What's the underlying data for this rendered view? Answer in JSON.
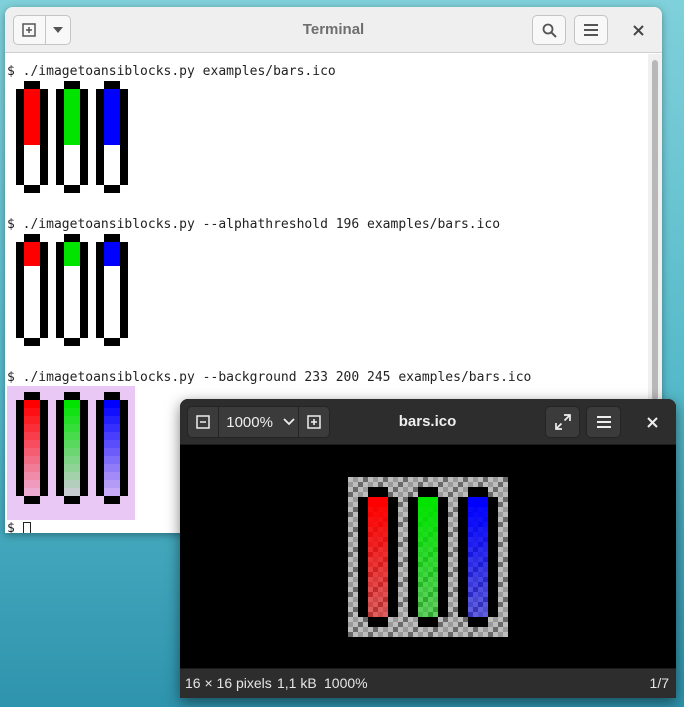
{
  "terminal": {
    "title": "Terminal",
    "icons": {
      "new_tab": "new-tab-icon",
      "menu_dropdown": "chevron-down-icon",
      "search": "search-icon",
      "hamburger": "hamburger-menu-icon",
      "close": "close-icon"
    },
    "commands": [
      "$ ./imagetoansiblocks.py examples/bars.ico",
      "$ ./imagetoansiblocks.py --alphathreshold 196 examples/bars.ico",
      "$ ./imagetoansiblocks.py --background 233 200 245 examples/bars.ico"
    ],
    "prompt": "$ ",
    "background_color": "#e9c8f5"
  },
  "viewer": {
    "title": "bars.ico",
    "zoom": "1000%",
    "icons": {
      "zoom_out": "zoom-out-icon",
      "zoom_dropdown": "chevron-down-icon",
      "zoom_in": "zoom-in-icon",
      "fullscreen": "fullscreen-icon",
      "menu": "hamburger-menu-icon",
      "close": "close-icon"
    },
    "status": {
      "dimensions": "16 × 16 pixels",
      "size": "1,1 kB",
      "zoom": "1000%",
      "position": "1/7"
    }
  },
  "bars": {
    "colors": [
      "#ff0000",
      "#00e400",
      "#0000ff"
    ]
  }
}
